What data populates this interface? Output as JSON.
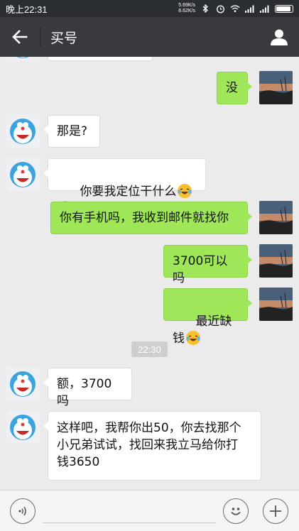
{
  "status_bar": {
    "time": "晚上22:31",
    "net_speed_up": "5.69K/s",
    "net_speed_down": "8.62K/s"
  },
  "header": {
    "title": "买号"
  },
  "messages": [
    {
      "side": "left",
      "text": ""
    },
    {
      "side": "right",
      "text": "没"
    },
    {
      "side": "left",
      "text": "那是?"
    },
    {
      "side": "left",
      "text": "你要我定位干什么"
    },
    {
      "side": "right",
      "text": "你有手机吗，我收到邮件就找你"
    },
    {
      "side": "right",
      "text": "3700可以吗"
    },
    {
      "side": "right",
      "text": "最近缺钱"
    },
    {
      "side": "left",
      "text": "额，3700吗"
    },
    {
      "side": "left",
      "text": "这样吧，我帮你出50，你去找那个\n小兄弟试试，找回来我立马给你打\n钱3650"
    }
  ],
  "timestamp": "22:30",
  "icons": {
    "back": "arrow-left-icon",
    "profile": "person-icon",
    "voice": "voice-icon",
    "emoji": "smiley-icon",
    "plus": "plus-icon",
    "emoji_in_message": "laughing-tears-emoji"
  },
  "colors": {
    "title_bar": "#393a3f",
    "status_bar": "#2a2d31",
    "chat_bg": "#ebebeb",
    "outgoing_bubble": "#9fe658",
    "incoming_bubble": "#ffffff"
  }
}
